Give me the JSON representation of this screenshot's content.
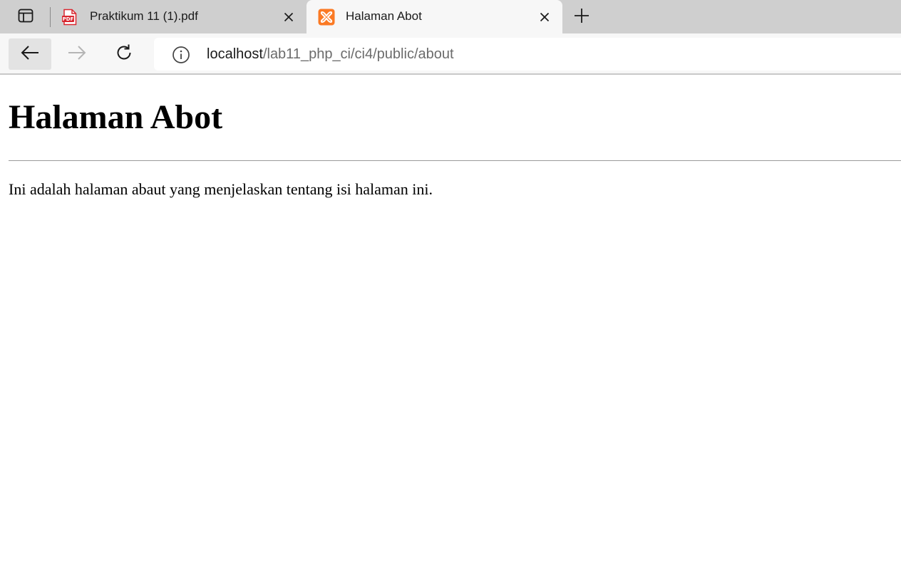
{
  "browser": {
    "tabs": [
      {
        "title": "Praktikum 11 (1).pdf",
        "favicon": "pdf-icon",
        "favicon_color": "#d9262f",
        "active": false
      },
      {
        "title": "Halaman Abot",
        "favicon": "xampp-icon",
        "favicon_color": "#fb7a24",
        "active": true
      }
    ],
    "address": {
      "host": "localhost",
      "path": "/lab11_php_ci/ci4/public/about"
    },
    "icons": {
      "tab_actions": "tab-actions-icon",
      "close": "close-icon",
      "new_tab": "plus-icon",
      "back": "back-arrow-icon",
      "forward": "forward-arrow-icon",
      "refresh": "refresh-icon",
      "site_info": "info-icon"
    }
  },
  "page": {
    "heading": "Halaman Abot",
    "paragraph": "Ini adalah halaman abaut yang menjelaskan tentang isi halaman ini."
  },
  "colors": {
    "tabstrip_bg": "#cfcfcf",
    "active_tab_bg": "#f7f7f7",
    "pdf_red": "#d9262f",
    "xampp_orange": "#fb7a24"
  }
}
